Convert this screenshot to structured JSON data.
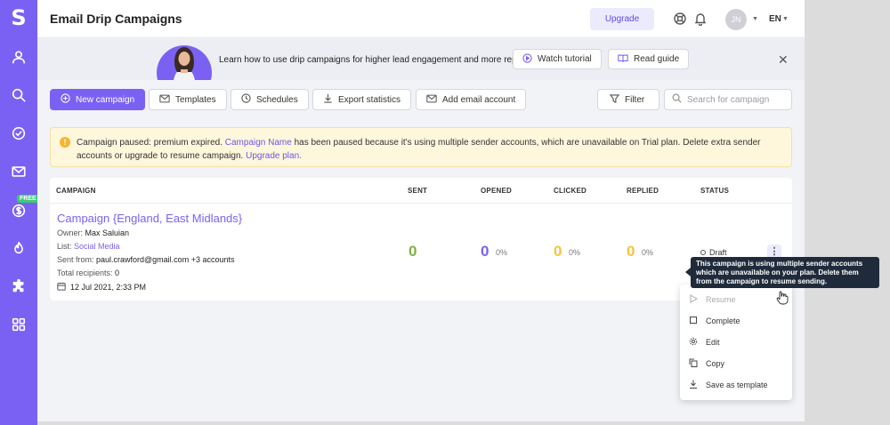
{
  "app": {
    "logo": "S",
    "title": "Email Drip Campaigns"
  },
  "sidebar": {
    "items": [
      {
        "name": "user-icon"
      },
      {
        "name": "search-icon"
      },
      {
        "name": "check-circle-icon"
      },
      {
        "name": "mail-icon"
      },
      {
        "name": "dollar-icon"
      },
      {
        "name": "fire-icon"
      },
      {
        "name": "puzzle-icon"
      },
      {
        "name": "grid-icon"
      }
    ],
    "free_badge": "FREE"
  },
  "topbar": {
    "upgrade_label": "Upgrade",
    "avatar_initials": "JN",
    "language": "EN"
  },
  "banner": {
    "text": "Learn how to use drip campaigns for higher lead engagement and more replies",
    "watch_label": "Watch tutorial",
    "read_label": "Read guide",
    "close": "✕"
  },
  "toolbar": {
    "new_campaign": "New campaign",
    "templates": "Templates",
    "schedules": "Schedules",
    "export": "Export statistics",
    "add_account": "Add email account",
    "filter": "Filter",
    "search_placeholder": "Search for campaign"
  },
  "alert": {
    "part1": "Campaign paused: premium expired. ",
    "campaign_link": "Campaign Name",
    "part2": " has been paused because it's using multiple sender accounts, which are unavailable on Trial plan. Delete extra sender accounts or upgrade to resume campaign. ",
    "upgrade_link": "Upgrade plan."
  },
  "table": {
    "headers": {
      "campaign": "CAMPAIGN",
      "sent": "SENT",
      "opened": "OPENED",
      "clicked": "CLICKED",
      "replied": "REPLIED",
      "status": "STATUS"
    },
    "row": {
      "name": "Campaign {England, East Midlands}",
      "owner_label": "Owner: ",
      "owner": "Max Saluian",
      "list_label": "List: ",
      "list": "Social Media",
      "sent_from_label": "Sent from: ",
      "sent_from": "paul.crawford@gmail.com +3 accounts",
      "recipients_label": "Total recipients: ",
      "recipients": "0",
      "date": "12 Jul 2021, 2:33 PM",
      "sent": "0",
      "opened": "0",
      "opened_pct": "0%",
      "clicked": "0",
      "clicked_pct": "0%",
      "replied": "0",
      "replied_pct": "0%",
      "status": "Draft",
      "more": "⋮"
    }
  },
  "menu": {
    "items": [
      {
        "label": "Resume",
        "disabled": true
      },
      {
        "label": "Complete"
      },
      {
        "label": "Edit"
      },
      {
        "label": "Copy"
      },
      {
        "label": "Save as template"
      }
    ]
  },
  "tooltip": "This campaign is using multiple sender accounts which are unavailable on your plan. Delete them from the campaign to resume sending.",
  "colors": {
    "accent": "#7b61f3",
    "sent": "#7cb342",
    "opened": "#7b61f3",
    "clicked": "#f5c242",
    "replied": "#f5c242"
  }
}
